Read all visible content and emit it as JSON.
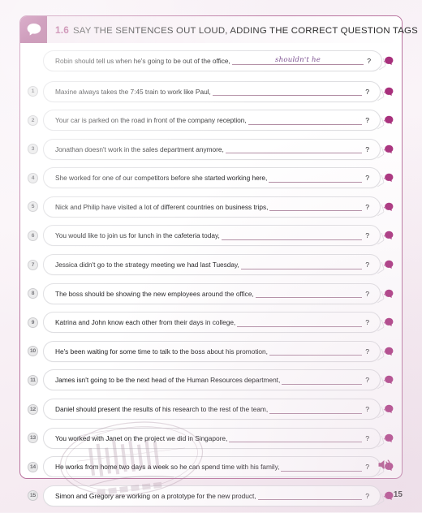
{
  "header": {
    "icon": "speech-bubble-icon",
    "number": "1.6",
    "title": "SAY THE SENTENCES OUT LOUD, ADDING THE CORRECT QUESTION TAGS"
  },
  "colors": {
    "accent": "#a8417e",
    "header_icon_bg": "#a84f87",
    "panel_border": "#b9749f",
    "answer_ink": "#7b4f8f",
    "blank_line": "#b08ba2",
    "page_bg": "#f7eff5",
    "badge_bg": "#e9e9ea"
  },
  "rows": [
    {
      "num": "",
      "is_example": true,
      "sentence": "Robin should tell us when he's going to be out of the office,",
      "answer": "shouldn't he",
      "qmark": "?",
      "speak_icon": "speaking-head-icon"
    },
    {
      "num": "1",
      "is_example": false,
      "sentence": "Maxine always takes the 7:45 train to work like Paul,",
      "answer": "",
      "qmark": "?",
      "speak_icon": "speaking-head-icon"
    },
    {
      "num": "2",
      "is_example": false,
      "sentence": "Your car is parked on the road in front of the company reception,",
      "answer": "",
      "qmark": "?",
      "speak_icon": "speaking-head-icon"
    },
    {
      "num": "3",
      "is_example": false,
      "sentence": "Jonathan doesn't work in the sales department anymore,",
      "answer": "",
      "qmark": "?",
      "speak_icon": "speaking-head-icon"
    },
    {
      "num": "4",
      "is_example": false,
      "sentence": "She worked for one of our competitors before she started working here,",
      "answer": "",
      "qmark": "?",
      "speak_icon": "speaking-head-icon"
    },
    {
      "num": "5",
      "is_example": false,
      "sentence": "Nick and Philip have visited a lot of different countries on business trips,",
      "answer": "",
      "qmark": "?",
      "speak_icon": "speaking-head-icon"
    },
    {
      "num": "6",
      "is_example": false,
      "sentence": "You would like to join us for lunch in the cafeteria today,",
      "answer": "",
      "qmark": "?",
      "speak_icon": "speaking-head-icon"
    },
    {
      "num": "7",
      "is_example": false,
      "sentence": "Jessica didn't go to the strategy meeting we had last Tuesday,",
      "answer": "",
      "qmark": "?",
      "speak_icon": "speaking-head-icon"
    },
    {
      "num": "8",
      "is_example": false,
      "sentence": "The boss should be showing the new employees around the office,",
      "answer": "",
      "qmark": "?",
      "speak_icon": "speaking-head-icon"
    },
    {
      "num": "9",
      "is_example": false,
      "sentence": "Katrina and John know each other from their days in college,",
      "answer": "",
      "qmark": "?",
      "speak_icon": "speaking-head-icon"
    },
    {
      "num": "10",
      "is_example": false,
      "sentence": "He's been waiting for some time to talk to the boss about his promotion,",
      "answer": "",
      "qmark": "?",
      "speak_icon": "speaking-head-icon"
    },
    {
      "num": "11",
      "is_example": false,
      "sentence": "James isn't going to be the next head of the Human Resources department,",
      "answer": "",
      "qmark": "?",
      "speak_icon": "speaking-head-icon"
    },
    {
      "num": "12",
      "is_example": false,
      "sentence": "Daniel should present the results of his research to the rest of the team,",
      "answer": "",
      "qmark": "?",
      "speak_icon": "speaking-head-icon"
    },
    {
      "num": "13",
      "is_example": false,
      "sentence": "You worked with Janet on the project we did in Singapore,",
      "answer": "",
      "qmark": "?",
      "speak_icon": "speaking-head-icon"
    },
    {
      "num": "14",
      "is_example": false,
      "sentence": "He works from home two days a week so he can spend time with his family,",
      "answer": "",
      "qmark": "?",
      "speak_icon": "speaking-head-icon"
    },
    {
      "num": "15",
      "is_example": false,
      "sentence": "Simon and Gregory are working on a prototype for the new product,",
      "answer": "",
      "qmark": "?",
      "speak_icon": "speaking-head-icon"
    }
  ],
  "audio": {
    "icon": "speaker-icon"
  },
  "footer": {
    "page_number": "15"
  }
}
